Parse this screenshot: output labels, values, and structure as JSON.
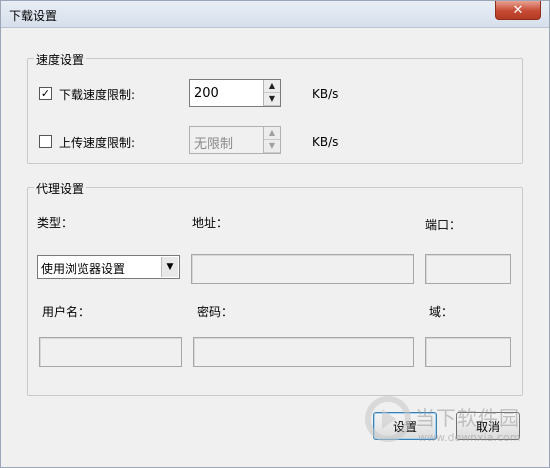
{
  "window": {
    "title": "下载设置",
    "close_glyph": "✕"
  },
  "speed": {
    "legend": "速度设置",
    "download": {
      "checked": true,
      "check_glyph": "✓",
      "label": "下载速度限制:",
      "value": "200",
      "unit": "KB/s"
    },
    "upload": {
      "checked": false,
      "check_glyph": "",
      "label": "上传速度限制:",
      "value": "无限制",
      "unit": "KB/s"
    }
  },
  "proxy": {
    "legend": "代理设置",
    "type_label": "类型：",
    "address_label": "地址：",
    "port_label": "端口：",
    "type_value": "使用浏览器设置",
    "username_label": "用户名：",
    "password_label": "密码：",
    "domain_label": "域："
  },
  "buttons": {
    "ok": "设置",
    "cancel": "取消"
  },
  "watermark": {
    "text": "当下软件园",
    "url": "www.downxia.com"
  },
  "icons": {
    "spin_up": "▲",
    "spin_down": "▼",
    "dropdown": "▼"
  }
}
